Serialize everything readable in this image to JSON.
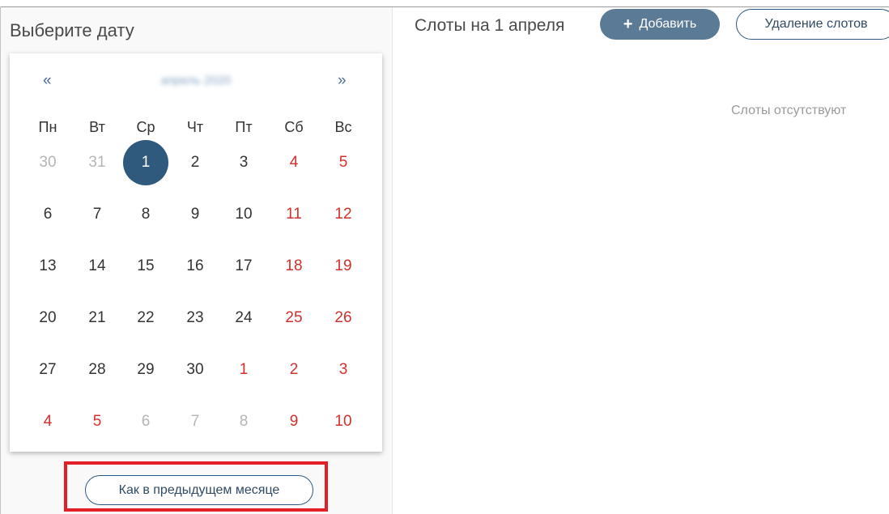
{
  "left": {
    "title": "Выберите дату"
  },
  "calendar": {
    "prev_arrow": "«",
    "next_arrow": "»",
    "month_label": "апрель 2020",
    "weekdays": [
      "Пн",
      "Вт",
      "Ср",
      "Чт",
      "Пт",
      "Сб",
      "Вс"
    ],
    "weeks": [
      [
        "30",
        "31",
        "1",
        "2",
        "3",
        "4",
        "5"
      ],
      [
        "6",
        "7",
        "8",
        "9",
        "10",
        "11",
        "12"
      ],
      [
        "13",
        "14",
        "15",
        "16",
        "17",
        "18",
        "19"
      ],
      [
        "20",
        "21",
        "22",
        "23",
        "24",
        "25",
        "26"
      ],
      [
        "27",
        "28",
        "29",
        "30",
        "1",
        "2",
        "3"
      ],
      [
        "4",
        "5",
        "6",
        "7",
        "8",
        "9",
        "10"
      ]
    ],
    "selected_day": "1"
  },
  "copy_button": {
    "label": "Как в предыдущем месяце"
  },
  "right": {
    "title": "Слоты на 1 апреля",
    "add_label": "Добавить",
    "delete_label": "Удаление слотов",
    "empty_text": "Слоты отсутствуют"
  },
  "colors": {
    "accent": "#2f5a7d",
    "weekend": "#d0302c",
    "highlight": "#e21e26"
  }
}
